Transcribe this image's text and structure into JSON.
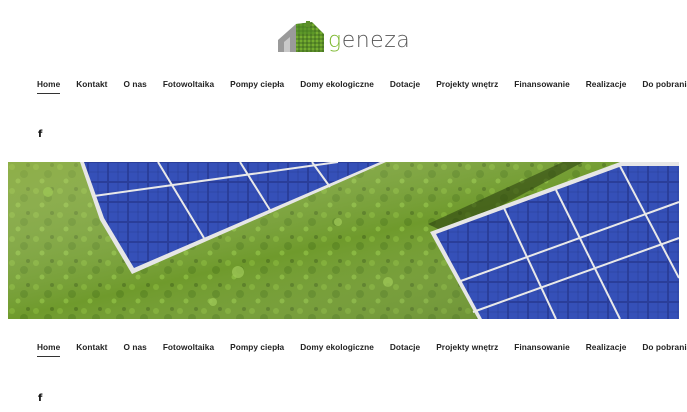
{
  "brand": {
    "logo_prefix": "g",
    "logo_rest": "eneza",
    "logo_icon": "house-grass-icon",
    "accent_color": "#7cb82f"
  },
  "nav": {
    "items": [
      {
        "label": "Home",
        "active": true
      },
      {
        "label": "Kontakt"
      },
      {
        "label": "O nas"
      },
      {
        "label": "Fotowoltaika"
      },
      {
        "label": "Pompy ciepła"
      },
      {
        "label": "Domy ekologiczne"
      },
      {
        "label": "Dotacje"
      },
      {
        "label": "Projekty wnętrz"
      },
      {
        "label": "Finansowanie"
      },
      {
        "label": "Realizacje"
      },
      {
        "label": "Do pobrania"
      }
    ]
  },
  "social": {
    "facebook_icon": "facebook-icon",
    "facebook_glyph": "f"
  },
  "hero": {
    "image_subject": "solar-panels-on-grass"
  }
}
